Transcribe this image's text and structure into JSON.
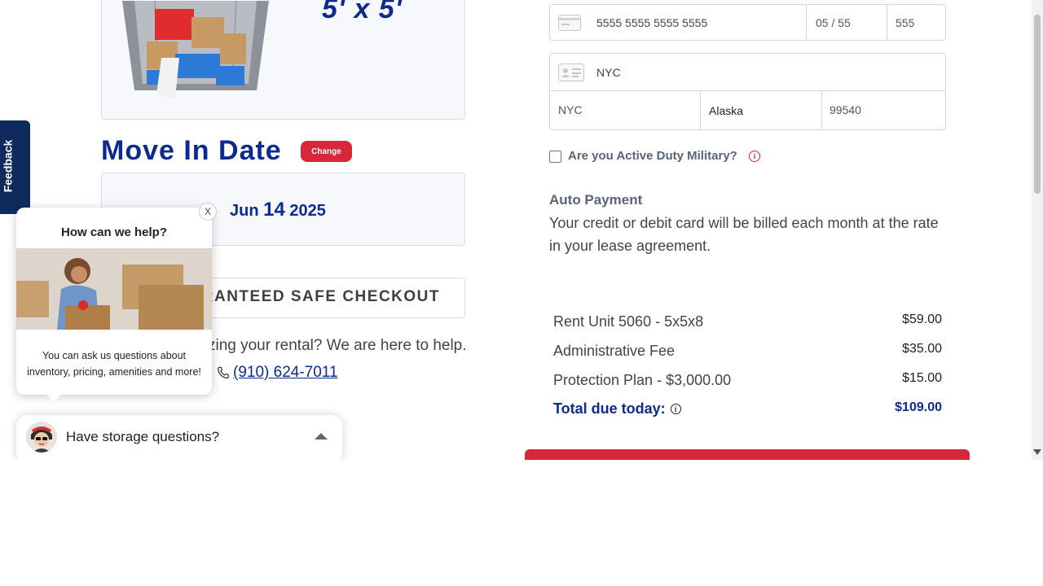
{
  "unit": {
    "size": "5' x 5'"
  },
  "move_in": {
    "title": "Move In Date",
    "change_label": "Change",
    "date_month": "Jun",
    "date_day": "14",
    "date_year": "2025"
  },
  "checkout": {
    "guarantee_label": "GUARANTEED SAFE CHECKOUT"
  },
  "help": {
    "text": "Need help finalizing your rental? We are here to help.",
    "phone": "(910) 624-7011"
  },
  "feedback": {
    "label": "Feedback"
  },
  "chat_popup": {
    "close_label": "X",
    "title": "How can we help?",
    "description": "You can ask us questions about inventory, pricing, amenities and more!"
  },
  "chat_bar": {
    "label": "Have storage questions?"
  },
  "payment_form": {
    "card_number": "5555 5555 5555 5555",
    "expiry": "05 / 55",
    "cvv": "555",
    "address_line": "NYC",
    "city": "NYC",
    "state": "Alaska",
    "zip": "99540"
  },
  "military": {
    "label": "Are you Active Duty Military?",
    "checked": false
  },
  "auto_payment": {
    "title": "Auto Payment",
    "description": "Your credit or debit card will be billed each month at the rate in your lease agreement."
  },
  "summary": {
    "lines": [
      {
        "label": "Rent Unit 5060 - 5x5x8",
        "amount": "$59.00"
      },
      {
        "label": "Administrative Fee",
        "amount": "$35.00"
      },
      {
        "label": "Protection Plan - $3,000.00",
        "amount": "$15.00"
      }
    ],
    "total_label": "Total due today:",
    "total_amount": "$109.00"
  },
  "colors": {
    "brand_blue": "#0f2a8c",
    "accent_red": "#d8263a",
    "feedback_navy": "#0f2a5c"
  }
}
